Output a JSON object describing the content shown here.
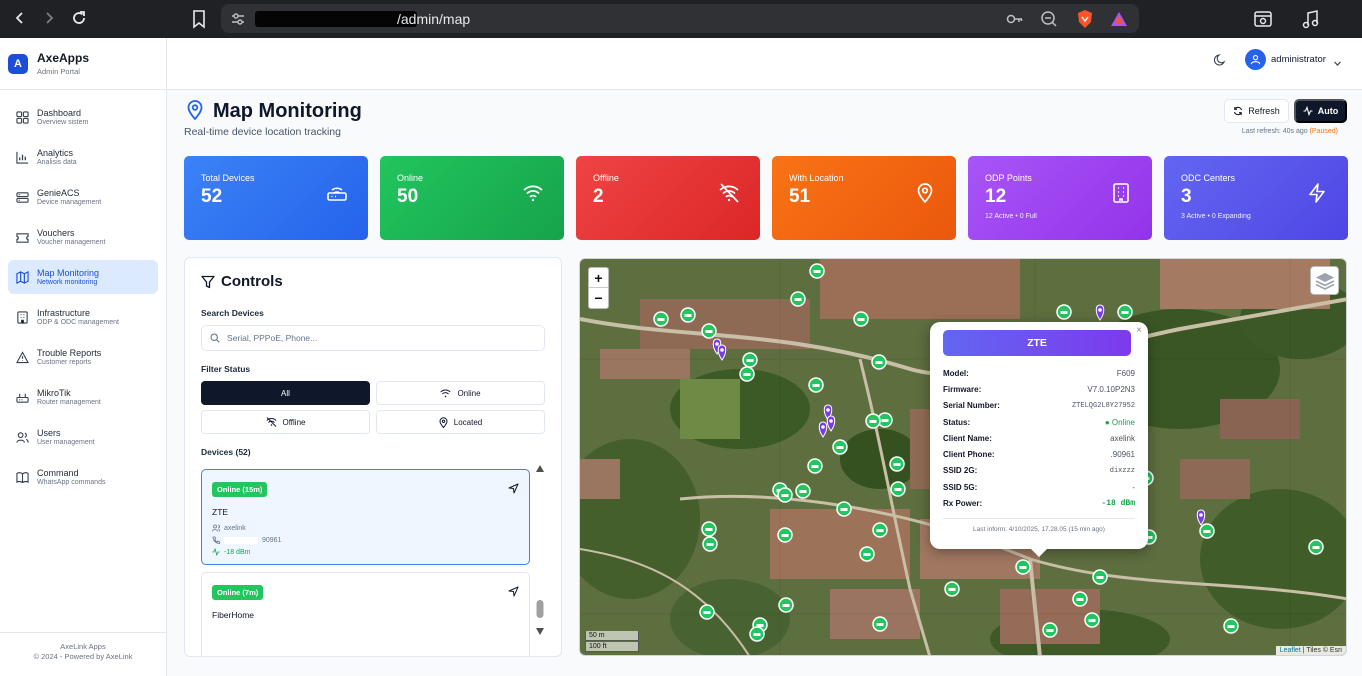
{
  "browser": {
    "url_visible": "/admin/map",
    "icons": [
      "back-icon",
      "forward-icon",
      "reload-icon",
      "bookmark-icon",
      "site-settings-icon",
      "key-icon",
      "zoom-out-icon",
      "brave-shield-icon",
      "brave-rewards-icon",
      "screenshot-icon",
      "media-icon"
    ]
  },
  "sidebar": {
    "brand_logo": "A",
    "brand_name": "AxeApps",
    "brand_sub": "Admin Portal",
    "items": [
      {
        "label": "Dashboard",
        "sub": "Overview sistem",
        "icon": "grid-icon"
      },
      {
        "label": "Analytics",
        "sub": "Analisis data",
        "icon": "bar-chart-icon"
      },
      {
        "label": "GenieACS",
        "sub": "Device management",
        "icon": "server-icon"
      },
      {
        "label": "Vouchers",
        "sub": "Voucher management",
        "icon": "ticket-icon"
      },
      {
        "label": "Map Monitoring",
        "sub": "Network monitoring",
        "icon": "map-icon",
        "active": true
      },
      {
        "label": "Infrastructure",
        "sub": "ODP & ODC management",
        "icon": "building-icon"
      },
      {
        "label": "Trouble Reports",
        "sub": "Customer reports",
        "icon": "alert-triangle-icon"
      },
      {
        "label": "MikroTik",
        "sub": "Router management",
        "icon": "router-icon"
      },
      {
        "label": "Users",
        "sub": "User management",
        "icon": "users-icon"
      },
      {
        "label": "Command",
        "sub": "WhatsApp commands",
        "icon": "book-icon"
      }
    ],
    "footer_line1": "AxeLink Apps",
    "footer_line2": "© 2024 - Powered by AxeLink"
  },
  "topbar": {
    "username": "administrator"
  },
  "header": {
    "title": "Map Monitoring",
    "subtitle": "Real-time device location tracking",
    "refresh_label": "Refresh",
    "auto_label": "Auto",
    "last_refresh": "Last refresh: 40s ago",
    "paused": "(Paused)"
  },
  "stats": [
    {
      "label": "Total Devices",
      "value": "52",
      "sub": "",
      "color_from": "#3b82f6",
      "color_to": "#2563eb",
      "icon": "router-icon"
    },
    {
      "label": "Online",
      "value": "50",
      "sub": "",
      "color_from": "#22c55e",
      "color_to": "#16a34a",
      "icon": "wifi-icon"
    },
    {
      "label": "Offline",
      "value": "2",
      "sub": "",
      "color_from": "#ef4444",
      "color_to": "#dc2626",
      "icon": "wifi-off-icon"
    },
    {
      "label": "With Location",
      "value": "51",
      "sub": "",
      "color_from": "#f97316",
      "color_to": "#ea580c",
      "icon": "map-pin-icon"
    },
    {
      "label": "ODP Points",
      "value": "12",
      "sub": "12 Active • 0 Full",
      "color_from": "#a855f7",
      "color_to": "#9333ea",
      "icon": "building-icon"
    },
    {
      "label": "ODC Centers",
      "value": "3",
      "sub": "3 Active • 0 Expanding",
      "color_from": "#6366f1",
      "color_to": "#4f46e5",
      "icon": "zap-icon"
    }
  ],
  "controls": {
    "title": "Controls",
    "search_label": "Search Devices",
    "search_placeholder": "Serial, PPPoE, Phone...",
    "filter_label": "Filter Status",
    "filters": [
      {
        "label": "All",
        "selected": true
      },
      {
        "label": "Online",
        "icon": "wifi-icon"
      },
      {
        "label": "Offline",
        "icon": "wifi-off-icon"
      },
      {
        "label": "Located",
        "icon": "map-pin-icon"
      }
    ],
    "devices_label": "Devices (52)",
    "devices": [
      {
        "status": "Online (15m)",
        "name": "ZTE",
        "user": "axelink",
        "phone": "90961",
        "rx": "-18 dBm",
        "selected": true
      },
      {
        "status": "Online (7m)",
        "name": "FiberHome",
        "user": "",
        "phone": "",
        "rx": ""
      }
    ]
  },
  "map": {
    "zoom_in": "+",
    "zoom_out": "−",
    "scale_metric": "50 m",
    "scale_imperial": "100 ft",
    "attribution_leaflet": "Leaflet",
    "attribution_rest": " | Tiles © Esri",
    "popup": {
      "title": "ZTE",
      "close": "×",
      "rows": [
        {
          "k": "Model:",
          "v": "F609"
        },
        {
          "k": "Firmware:",
          "v": "V7.0.10P2N3"
        },
        {
          "k": "Serial Number:",
          "v": "ZTELQG2L8Y27952"
        },
        {
          "k": "Status:",
          "v": "● Online"
        },
        {
          "k": "Client Name:",
          "v": "axelink"
        },
        {
          "k": "Client Phone:",
          "v": ".90961"
        },
        {
          "k": "SSID 2G:",
          "v": "dixzzz"
        },
        {
          "k": "SSID 5G:",
          "v": "-"
        },
        {
          "k": "Rx Power:",
          "v": "-18 dBm"
        }
      ],
      "footer": "Last inform: 4/10/2025, 17.28.05 (15 min ago)"
    }
  }
}
